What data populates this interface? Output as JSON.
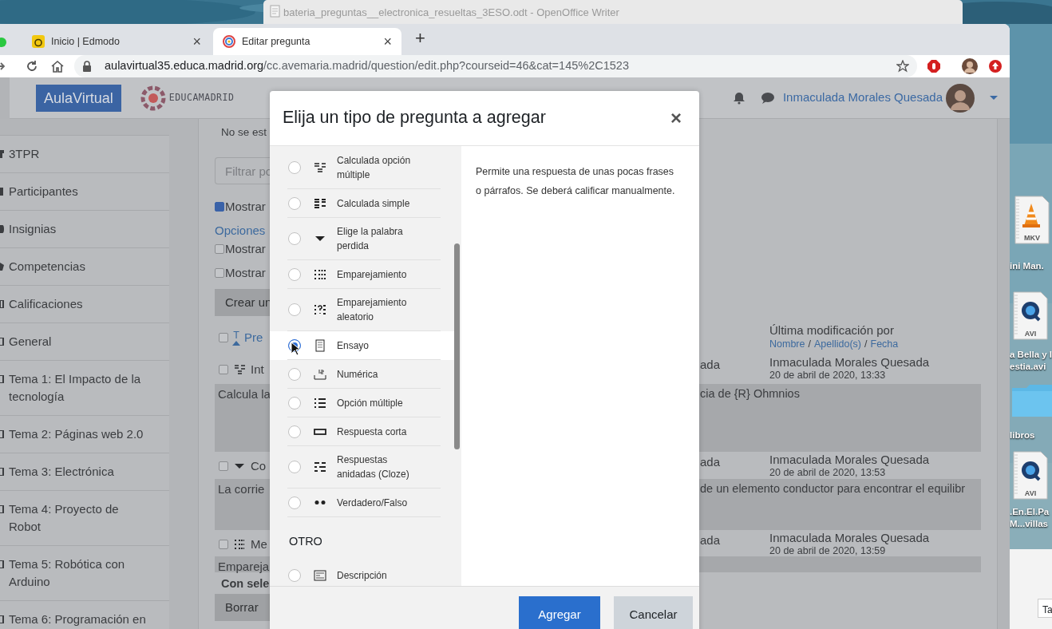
{
  "background_window": {
    "title": "bateria_preguntas__electronica_resueltas_3ESO.odt - OpenOffice Writer"
  },
  "desktop_icons": [
    {
      "kind": "cone",
      "badge": "MKV",
      "label": [
        "ini Man."
      ]
    },
    {
      "kind": "quicktime",
      "badge": "AVI",
      "label": [
        "a Bella y l",
        "estia.avi"
      ]
    },
    {
      "kind": "folder",
      "label": [
        "libros"
      ]
    },
    {
      "kind": "quicktime",
      "badge": "AVI",
      "label": [
        ".En.El.Pa",
        "M...villas"
      ]
    }
  ],
  "corner_window": {
    "tab": "Ta"
  },
  "browser": {
    "tabs": [
      {
        "title": "Inicio | Edmodo",
        "close": "×",
        "selected": false
      },
      {
        "title": "Editar pregunta",
        "close": "×",
        "selected": true
      }
    ],
    "new_tab": "+",
    "url_host": "aulavirtual35.educa.madrid.org",
    "url_path": "/cc.avemaria.madrid/question/edit.php?courseid=46&cat=145%2C1523"
  },
  "site_header": {
    "brand": "AulaVirtual",
    "logo_text": "EDUCAMADRID",
    "user_name": "Inmaculada Morales Quesada"
  },
  "sidebar": {
    "items": [
      {
        "label": "3TPR",
        "kind": "course"
      },
      {
        "label": "Participantes",
        "kind": "users"
      },
      {
        "label": "Insignias",
        "kind": "badge"
      },
      {
        "label": "Competencias",
        "kind": "check"
      },
      {
        "label": "Calificaciones",
        "kind": "table"
      },
      {
        "label": "General",
        "kind": "folder"
      },
      {
        "label": "Tema 1: El Impacto de la tecnología",
        "kind": "folder"
      },
      {
        "label": "Tema 2: Páginas web 2.0",
        "kind": "folder"
      },
      {
        "label": "Tema 3: Electrónica",
        "kind": "folder"
      },
      {
        "label": "Tema 4: Proyecto de Robot",
        "kind": "folder"
      },
      {
        "label": "Tema 5: Robótica con Arduino",
        "kind": "folder"
      },
      {
        "label": "Tema 6: Programación en",
        "kind": "folder"
      }
    ]
  },
  "page": {
    "notice": "No se est",
    "filter_placeholder": "Filtrar po",
    "options": [
      {
        "kind": "checkbox",
        "label": "Mostrar",
        "checked": true
      },
      {
        "kind": "link",
        "label": "Opciones"
      },
      {
        "kind": "checkbox",
        "label": "Mostrar",
        "checked": false
      },
      {
        "kind": "checkbox",
        "label": "Mostrar",
        "checked": false
      }
    ],
    "create_button": "Crear un",
    "table": {
      "header_checked": false,
      "sort_label": "T",
      "first_heading": "Pre",
      "last_heading": "Última modificación por",
      "sort_links": [
        {
          "label": "Nombre"
        },
        {
          "label": "Apellido(s)"
        },
        {
          "label": "Fecha"
        }
      ],
      "separators": [
        "/",
        "/"
      ],
      "rows": [
        {
          "kind": "calculated",
          "checked": false,
          "name": "Int",
          "creator": "ada",
          "modifier": "Inmaculada Morales Quesada",
          "date": "20 de abril de 2020, 13:33",
          "text_left": "Calcula  la",
          "text_right": "cia de {R} Ohmnios"
        },
        {
          "kind": "gapselect",
          "checked": false,
          "name": "Co",
          "creator": "ada",
          "modifier": "Inmaculada Morales Quesada",
          "date": "20 de abril de 2020, 13:53",
          "text_left": "La  corrie",
          "text_right": "de un elemento conductor para encontrar el equilibr"
        },
        {
          "kind": "match",
          "checked": false,
          "name": "Me",
          "creator": "ada",
          "modifier": "Inmaculada Morales Quesada",
          "date": "20 de abril de 2020, 13:59",
          "text_left": "Empareja"
        }
      ]
    },
    "selection_label": "Con sele",
    "delete_button": "Borrar"
  },
  "modal": {
    "title": "Elija un tipo de pregunta a agregar",
    "close": "×",
    "types": [
      {
        "label": "Calculada opción múltiple",
        "kind": "calcmulti",
        "selected": false
      },
      {
        "label": "Calculada simple",
        "kind": "calcsimple",
        "selected": false
      },
      {
        "label": "Elige la palabra perdida",
        "kind": "gapselect",
        "selected": false
      },
      {
        "label": "Emparejamiento",
        "kind": "match",
        "selected": false
      },
      {
        "label": "Emparejamiento aleatorio",
        "kind": "randommatch",
        "selected": false
      },
      {
        "label": "Ensayo",
        "kind": "essay",
        "selected": true
      },
      {
        "label": "Numérica",
        "kind": "numerical",
        "selected": false
      },
      {
        "label": "Opción múltiple",
        "kind": "multichoice",
        "selected": false
      },
      {
        "label": "Respuesta corta",
        "kind": "shortanswer",
        "selected": false
      },
      {
        "label": "Respuestas anidadas (Cloze)",
        "kind": "cloze",
        "selected": false
      },
      {
        "label": "Verdadero/Falso",
        "kind": "truefalse",
        "selected": false
      }
    ],
    "other_heading": "OTRO",
    "other_types": [
      {
        "label": "Descripción",
        "kind": "description",
        "selected": false
      }
    ],
    "description": "Permite una respuesta de unas pocas frases o párrafos. Se deberá calificar manualmente.",
    "buttons": [
      {
        "label": "Agregar",
        "kind": "primary"
      },
      {
        "label": "Cancelar",
        "kind": "secondary"
      }
    ]
  }
}
